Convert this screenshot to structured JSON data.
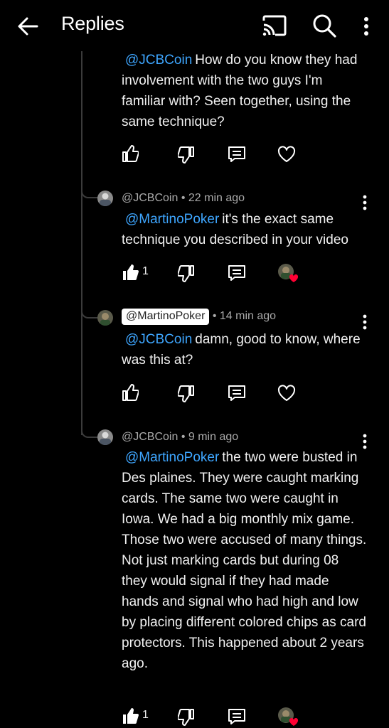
{
  "header": {
    "title": "Replies",
    "icons": [
      "back-arrow-icon",
      "cast-icon",
      "search-icon",
      "more-vert-icon"
    ]
  },
  "comments": [
    {
      "mention": "@JCBCoin",
      "body": "How do you know they had involvement with the two guys I'm familiar with?  Seen together, using the same technique?",
      "likes": ""
    },
    {
      "author": "@JCBCoin",
      "time": "22 min ago",
      "mention": "@MartinoPoker",
      "body": "it's the exact same technique you described in your video",
      "likes": "1"
    },
    {
      "author": "@MartinoPoker",
      "time": "14 min ago",
      "mention": "@JCBCoin",
      "body": "damn, good to know, where was this at?",
      "likes": ""
    },
    {
      "author": "@JCBCoin",
      "time": "9 min ago",
      "mention": "@MartinoPoker",
      "body": "the two were busted in Des plaines.    They were caught marking cards.  The same two were caught in Iowa.  We had a big monthly mix game.  Those two were accused of many things.  Not just marking cards but during 08 they would signal if they had made hands and signal who had high and low by placing different colored chips as card protectors.   This happened about 2 years ago.",
      "likes": "1"
    }
  ],
  "colors": {
    "background": "#000000",
    "mention": "#3ea6ff",
    "meta": "#aaaaaa",
    "heart": "#ff0033"
  },
  "separator": " • "
}
